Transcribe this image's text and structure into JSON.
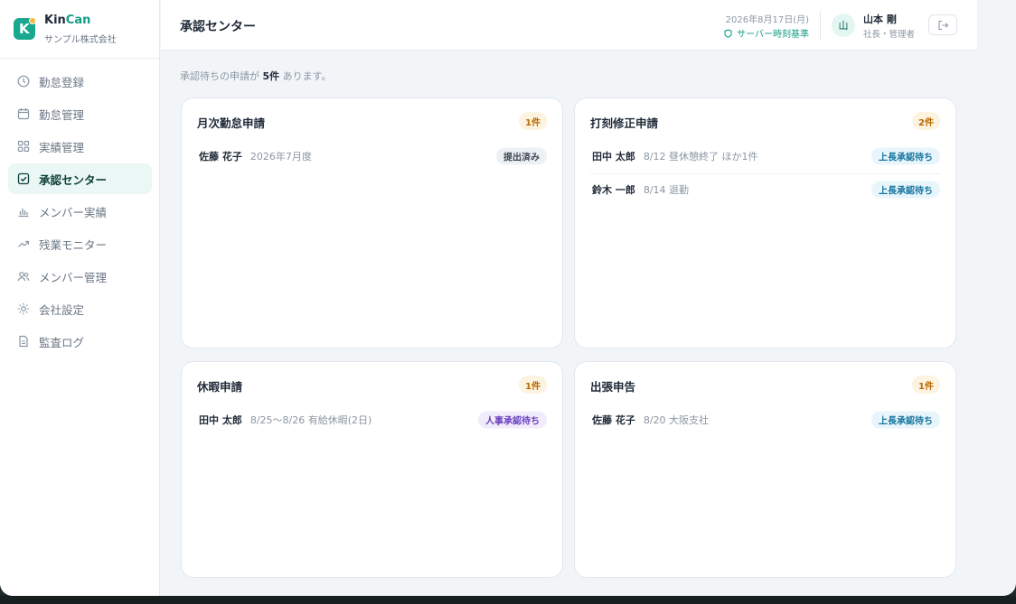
{
  "brand": {
    "name_part1": "Kin",
    "name_part2": "Can",
    "company": "サンプル株式会社",
    "logo_letter": "K"
  },
  "nav": [
    {
      "label": "勤怠登録",
      "icon": "clock-icon",
      "active": false
    },
    {
      "label": "勤怠管理",
      "icon": "calendar-icon",
      "active": false
    },
    {
      "label": "実績管理",
      "icon": "grid-icon",
      "active": false
    },
    {
      "label": "承認センター",
      "icon": "check-square-icon",
      "active": true
    },
    {
      "label": "メンバー実績",
      "icon": "bar-chart-icon",
      "active": false
    },
    {
      "label": "残業モニター",
      "icon": "trend-up-icon",
      "active": false
    },
    {
      "label": "メンバー管理",
      "icon": "users-icon",
      "active": false
    },
    {
      "label": "会社設定",
      "icon": "sun-gear-icon",
      "active": false
    },
    {
      "label": "監査ログ",
      "icon": "document-icon",
      "active": false
    }
  ],
  "header": {
    "title": "承認センター",
    "date": "2026年8月17日(月)",
    "server_time": "サーバー時刻基準",
    "avatar_initial": "山",
    "user_name": "山本 剛",
    "user_role": "社長・管理者"
  },
  "summary": {
    "prefix": "承認待ちの申請が",
    "count": "5件",
    "suffix": "あります。"
  },
  "cards": [
    {
      "title": "月次勤怠申請",
      "count": "1件",
      "rows": [
        {
          "name": "佐藤 花子",
          "detail": "2026年7月度",
          "status": "提出済み",
          "status_type": "gray"
        }
      ]
    },
    {
      "title": "打刻修正申請",
      "count": "2件",
      "rows": [
        {
          "name": "田中 太郎",
          "detail": "8/12 昼休憩終了 ほか1件",
          "status": "上長承認待ち",
          "status_type": "blue"
        },
        {
          "name": "鈴木 一郎",
          "detail": "8/14 退勤",
          "status": "上長承認待ち",
          "status_type": "blue"
        }
      ]
    },
    {
      "title": "休暇申請",
      "count": "1件",
      "rows": [
        {
          "name": "田中 太郎",
          "detail": "8/25〜8/26 有給休暇(2日)",
          "status": "人事承認待ち",
          "status_type": "purple"
        }
      ]
    },
    {
      "title": "出張申告",
      "count": "1件",
      "rows": [
        {
          "name": "佐藤 花子",
          "detail": "8/20 大阪支社",
          "status": "上長承認待ち",
          "status_type": "blue"
        }
      ]
    }
  ],
  "colors": {
    "accent": "#129e86",
    "badge_bg": "#fdf3e1",
    "badge_text": "#b86a00"
  }
}
